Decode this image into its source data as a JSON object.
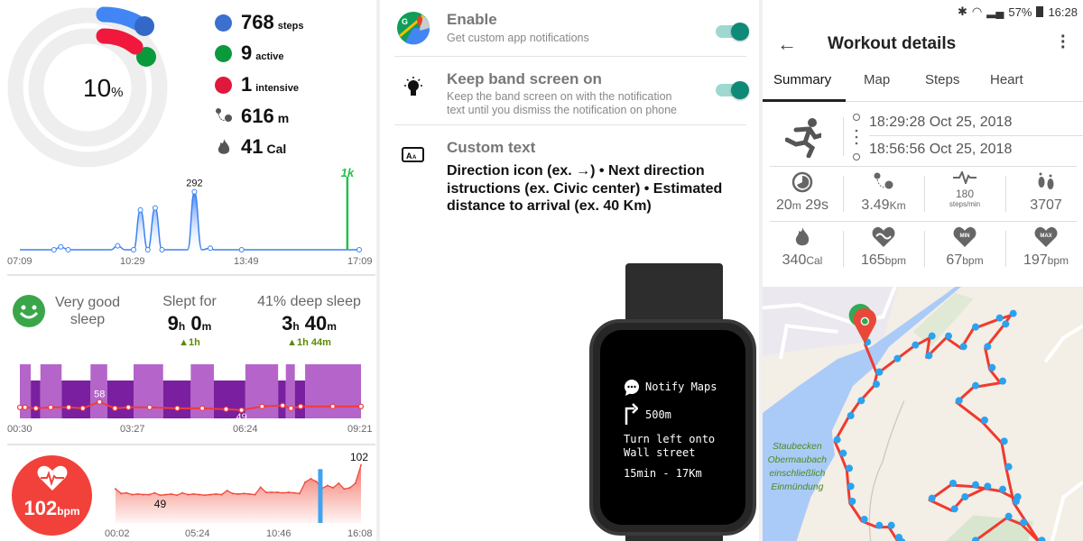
{
  "activity": {
    "percent": "10",
    "percent_unit": "%",
    "stats": [
      {
        "value": "768",
        "unit": "steps",
        "icon": "blue-dot",
        "color": "#3b6fd0"
      },
      {
        "value": "9",
        "unit": "active",
        "icon": "green-dot",
        "color": "#0a9a3c"
      },
      {
        "value": "1",
        "unit": "intensive",
        "icon": "red-dot",
        "color": "#e0183c"
      },
      {
        "value": "616",
        "unit": "m",
        "icon": "route-icon"
      },
      {
        "value": "41",
        "unit": "Cal",
        "icon": "flame-icon"
      }
    ],
    "ring_colors": {
      "steps": "#4285f4",
      "active": "#0a9a3c",
      "intensive": "#f0183c",
      "track": "#eeeeee"
    }
  },
  "chart_data": [
    {
      "type": "area",
      "xlim": [
        "07:09",
        "17:09"
      ],
      "x_ticks": [
        "07:09",
        "10:29",
        "13:49",
        "17:09"
      ],
      "ylim": [
        0,
        340
      ],
      "x": [
        "07:09",
        "08:09",
        "08:21",
        "08:34",
        "09:49",
        "10:01",
        "10:14",
        "10:29",
        "10:41",
        "10:54",
        "11:07",
        "11:19",
        "12:04",
        "12:16",
        "12:29",
        "12:44",
        "12:51",
        "13:39"
      ],
      "values": [
        0,
        0,
        15,
        0,
        0,
        20,
        0,
        0,
        200,
        0,
        210,
        0,
        0,
        292,
        0,
        8,
        0,
        0
      ],
      "peak_label": "292",
      "goal_marker": {
        "x": "16:45",
        "label": "1k",
        "color": "#22c04a"
      },
      "color": "#3d82f5"
    },
    {
      "type": "bar",
      "xlim": [
        "00:30",
        "09:21"
      ],
      "x_ticks": [
        "00:30",
        "03:27",
        "06:24",
        "09:21"
      ],
      "sleep_segments": [
        {
          "start": "00:30",
          "end": "00:47",
          "stage": "light"
        },
        {
          "start": "00:47",
          "end": "01:02",
          "stage": "deep"
        },
        {
          "start": "01:02",
          "end": "01:35",
          "stage": "light"
        },
        {
          "start": "01:35",
          "end": "02:20",
          "stage": "deep"
        },
        {
          "start": "02:20",
          "end": "02:46",
          "stage": "light"
        },
        {
          "start": "02:46",
          "end": "03:27",
          "stage": "deep"
        },
        {
          "start": "03:27",
          "end": "04:13",
          "stage": "light"
        },
        {
          "start": "04:13",
          "end": "04:56",
          "stage": "deep"
        },
        {
          "start": "04:56",
          "end": "05:32",
          "stage": "light"
        },
        {
          "start": "05:32",
          "end": "06:21",
          "stage": "deep"
        },
        {
          "start": "06:21",
          "end": "07:12",
          "stage": "light"
        },
        {
          "start": "07:12",
          "end": "07:24",
          "stage": "deep"
        },
        {
          "start": "07:24",
          "end": "07:38",
          "stage": "light"
        },
        {
          "start": "07:38",
          "end": "07:54",
          "stage": "deep"
        },
        {
          "start": "07:54",
          "end": "09:21",
          "stage": "light"
        }
      ],
      "stage_colors": {
        "light": "#b565c9",
        "deep": "#7a1fa0"
      },
      "heart_rate": {
        "x": [
          "00:30",
          "00:38",
          "00:55",
          "01:18",
          "01:46",
          "02:08",
          "02:34",
          "02:58",
          "03:19",
          "03:52",
          "04:35",
          "05:14",
          "05:51",
          "06:15",
          "06:47",
          "07:19",
          "07:32",
          "07:47",
          "08:37",
          "09:21"
        ],
        "values": [
          52,
          52,
          51,
          52,
          52,
          51,
          58,
          51,
          52,
          52,
          51,
          51,
          50,
          49,
          53,
          54,
          51,
          53,
          53,
          53
        ],
        "ylim": [
          40,
          100
        ],
        "max_label": "58",
        "min_label": "49",
        "color": "#f23a3a"
      }
    },
    {
      "type": "area",
      "xlim": [
        "00:02",
        "16:08"
      ],
      "x_ticks": [
        "00:02",
        "05:24",
        "10:46",
        "16:08"
      ],
      "ylim": [
        0,
        105
      ],
      "values": [
        60,
        52,
        53,
        50,
        51,
        50,
        50,
        53,
        49,
        50,
        51,
        49,
        53,
        50,
        51,
        50,
        49,
        50,
        51,
        50,
        57,
        52,
        51,
        52,
        51,
        50,
        63,
        54,
        54,
        54,
        53,
        54,
        53,
        52,
        72,
        78,
        73,
        61,
        66,
        62,
        70,
        60,
        62,
        70,
        102
      ],
      "max_label": "102",
      "min_label": "49",
      "marker_x": "13:28",
      "color": "#f04a3a",
      "marker_color": "#3fa4f0"
    }
  ],
  "sleep": {
    "quality": "Very good",
    "quality2": "sleep",
    "slept_label": "Slept for",
    "slept_h": "9",
    "slept_m": "0",
    "h": "h",
    "m": "m",
    "slept_delta": "▲1h",
    "deep_label": "41% deep sleep",
    "deep_h": "3",
    "deep_m": "40",
    "deep_delta": "▲1h 44m"
  },
  "heart": {
    "value": "102",
    "unit": "bpm",
    "color": "#f2413a"
  },
  "notify": {
    "rows": [
      {
        "title": "Enable",
        "sub": "Get custom app notifications",
        "toggle": true
      },
      {
        "title": "Keep band screen on",
        "sub": "Keep the band screen on with the notification text until you dismiss the notification on phone",
        "toggle": true
      },
      {
        "title": "Custom text",
        "body": "Direction icon (ex. →) • Next direction istructions (ex. Civic center) • Estimated distance to arrival (ex. 40 Km)"
      }
    ],
    "watch": {
      "app": "Notify Maps",
      "distance": "500m",
      "line1": "Turn left onto",
      "line2": "Wall street",
      "eta": "15min - 17Km"
    },
    "toggle_color": "#0f8a78"
  },
  "workout": {
    "status": {
      "battery": "57%",
      "time": "16:28"
    },
    "title": "Workout details",
    "tabs": [
      "Summary",
      "Map",
      "Steps",
      "Heart"
    ],
    "active_tab": "Summary",
    "start": "18:29:28 Oct 25, 2018",
    "end": "18:56:56 Oct 25, 2018",
    "stats": [
      {
        "icon": "timer-icon",
        "value": "20",
        "unit": "m",
        "value2": " 29s"
      },
      {
        "icon": "route-icon",
        "value": "3.49",
        "unit": "Km"
      },
      {
        "icon": "cadence-icon",
        "value": "180",
        "unit": "steps/min"
      },
      {
        "icon": "footsteps-icon",
        "value": "3707",
        "unit": ""
      },
      {
        "icon": "flame-icon",
        "value": "340",
        "unit": "Cal"
      },
      {
        "icon": "heart-avg-icon",
        "value": "165",
        "unit": "bpm"
      },
      {
        "icon": "heart-min-icon",
        "value": "67",
        "unit": "bpm",
        "badge": "MIN"
      },
      {
        "icon": "heart-max-icon",
        "value": "197",
        "unit": "bpm",
        "badge": "MAX"
      }
    ],
    "map": {
      "labels": [
        "Staubecken",
        "Obermaubach",
        "einschließlich",
        "Einmündung"
      ],
      "route_color": "#f03a2e",
      "point_color": "#29a3f0",
      "water_color": "#aacbf7",
      "land_color": "#f3eee6"
    }
  }
}
